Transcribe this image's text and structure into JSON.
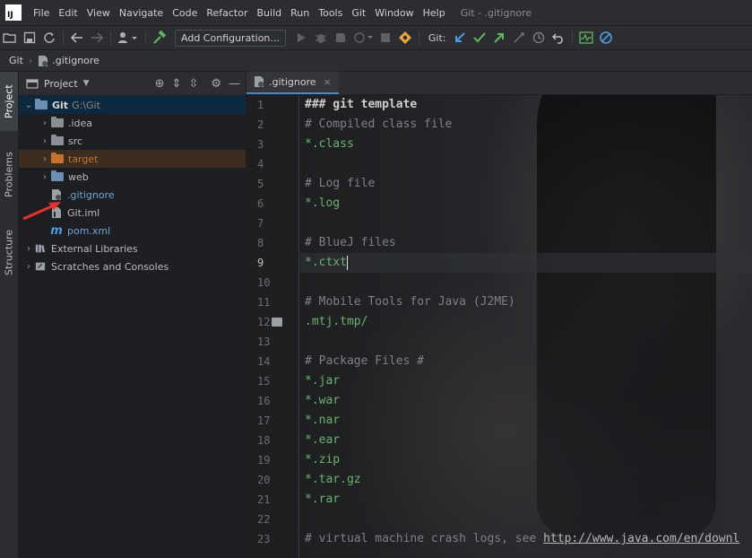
{
  "menubar": {
    "app_logo": "IJ",
    "items": [
      "File",
      "Edit",
      "View",
      "Navigate",
      "Code",
      "Refactor",
      "Build",
      "Run",
      "Tools",
      "Git",
      "Window",
      "Help"
    ],
    "window_title": "Git - .gitignore"
  },
  "toolbar": {
    "add_configuration": "Add Configuration...",
    "git_label": "Git:"
  },
  "breadcrumb": {
    "project": "Git",
    "file": ".gitignore"
  },
  "side_tabs": [
    "Project",
    "Problems",
    "Structure"
  ],
  "project_panel": {
    "title": "Project",
    "tree": [
      {
        "label": "Git",
        "path": "G:\\Git",
        "level": 0,
        "expanded": true,
        "selected": true
      },
      {
        "label": ".idea",
        "level": 1
      },
      {
        "label": "src",
        "level": 1
      },
      {
        "label": "target",
        "level": 1
      },
      {
        "label": "web",
        "level": 1
      },
      {
        "label": ".gitignore",
        "level": 1
      },
      {
        "label": "Git.iml",
        "level": 1
      },
      {
        "label": "pom.xml",
        "level": 1
      },
      {
        "label": "External Libraries",
        "level": 0
      },
      {
        "label": "Scratches and Consoles",
        "level": 0
      }
    ]
  },
  "editor": {
    "tab_label": ".gitignore",
    "line_numbers": [
      "1",
      "2",
      "3",
      "4",
      "5",
      "6",
      "7",
      "8",
      "9",
      "10",
      "11",
      "12",
      "13",
      "14",
      "15",
      "16",
      "17",
      "18",
      "19",
      "20",
      "21",
      "22",
      "23"
    ],
    "current_line": 9,
    "lines": [
      "### git template",
      "# Compiled class file",
      "*.class",
      "",
      "# Log file",
      "*.log",
      "",
      "# BlueJ files",
      "*.ctxt",
      "",
      "# Mobile Tools for Java (J2ME)",
      ".mtj.tmp/",
      "",
      "# Package Files #",
      "*.jar",
      "*.war",
      "*.nar",
      "*.ear",
      "*.zip",
      "*.tar.gz",
      "*.rar",
      "",
      "# virtual machine crash logs, see "
    ],
    "line23_link": "http://www.java.com/en/downl"
  },
  "colors": {
    "accent": "#4a88c7",
    "selection": "#0d293e",
    "excluded_folder": "#c8712b",
    "string_green": "#6ab26d"
  }
}
